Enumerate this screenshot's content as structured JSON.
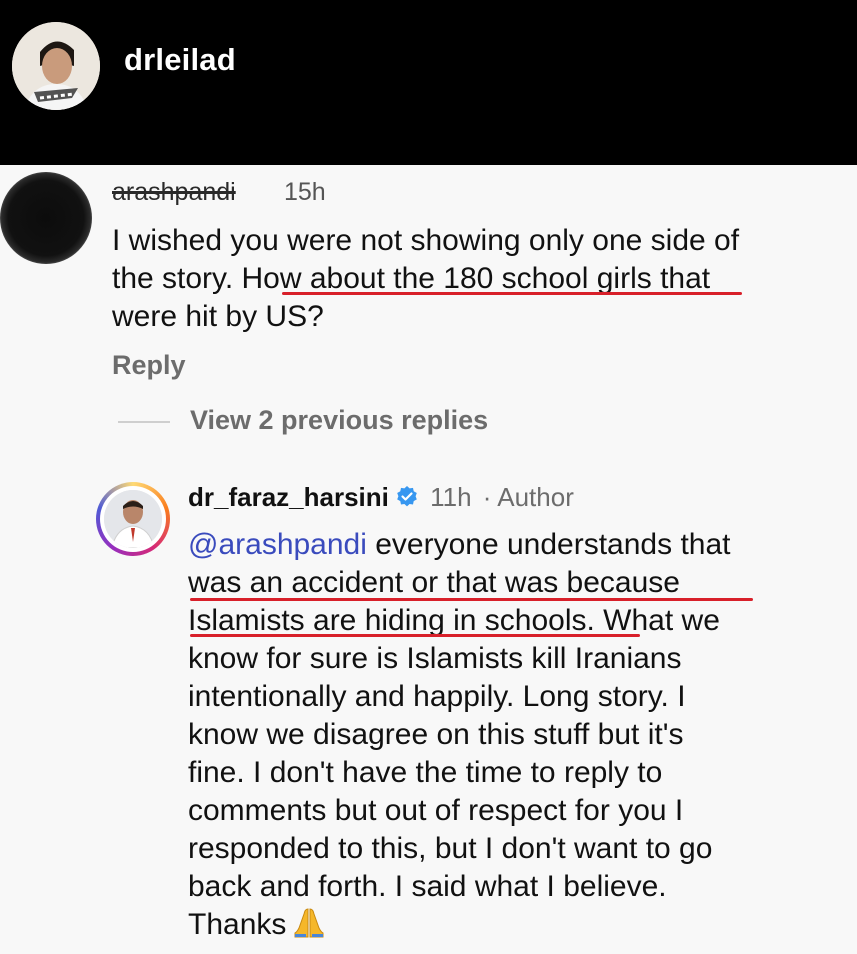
{
  "header": {
    "username": "drleilad"
  },
  "comment1": {
    "username": "arashpandi",
    "time": "15h",
    "lines": [
      "I wished you were not showing only one side of",
      "the story. How about the 180 school girls that",
      "were hit by US?"
    ],
    "reply_label": "Reply"
  },
  "view_replies_label": "View 2 previous replies",
  "comment2": {
    "username": "dr_faraz_harsini",
    "time": "11h",
    "author_label": "· Author",
    "mention": "@arashpandi",
    "line1_rest": " everyone understands that",
    "lines": [
      "was an accident or that was because",
      "Islamists are hiding in schools. What we",
      "know for sure is Islamists kill Iranians",
      "intentionally and happily. Long story. I",
      "know we disagree on this stuff but it's",
      "fine. I don't have the time to reply to",
      "comments but out of respect for you I",
      "responded to this, but I don't want to go",
      "back and forth. I said what I believe."
    ],
    "last_line": "Thanks"
  },
  "colors": {
    "header_bg": "#000000",
    "mention": "#3a4bbd",
    "verified": "#3797f0",
    "underline": "#d8202a"
  }
}
